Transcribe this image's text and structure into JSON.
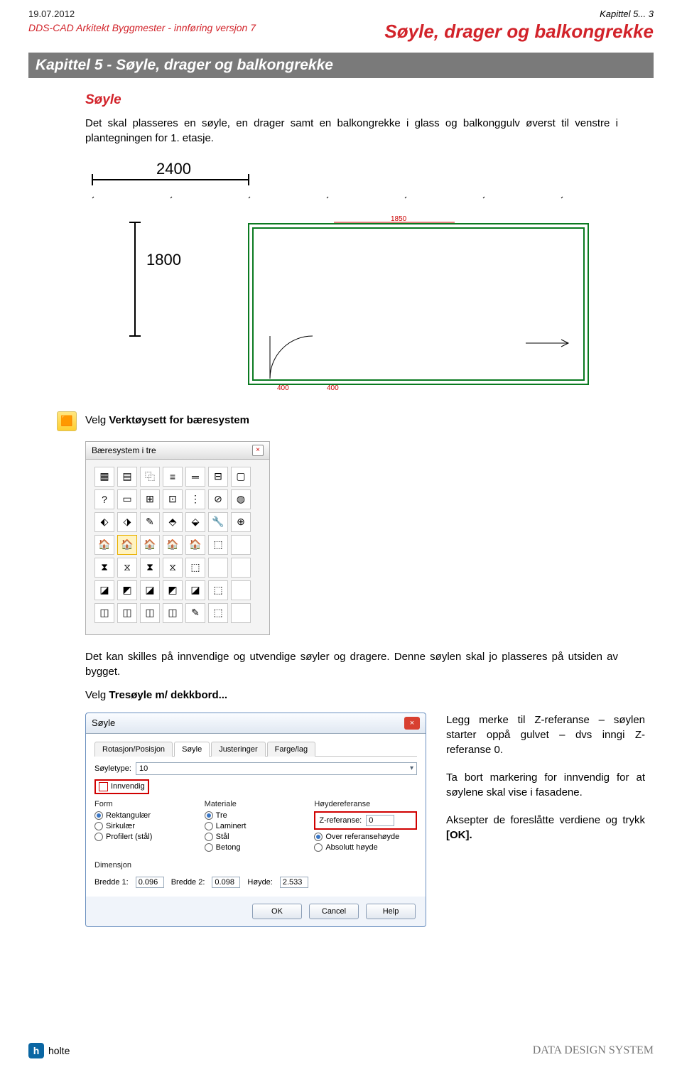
{
  "header": {
    "date": "19.07.2012",
    "subline": "DDS-CAD Arkitekt Byggmester - innføring versjon 7",
    "chapter_ref": "Kapittel 5... 3",
    "title": "Søyle, drager og balkongrekke"
  },
  "chapter_bar": "Kapittel 5  - Søyle, drager og balkongrekke",
  "section": {
    "heading": "Søyle",
    "intro": "Det skal plasseres en søyle, en drager samt en balkongrekke i glass og balkonggulv øverst til venstre i plantegningen for 1. etasje."
  },
  "plan": {
    "dim_top": "2400",
    "dim_left": "1800",
    "small_dim_1850": "1850",
    "small_dim_400a": "400",
    "small_dim_400b": "400"
  },
  "tool_line": {
    "prefix": "Velg ",
    "bold": "Verktøysett for bæresystem"
  },
  "palette": {
    "title": "Bæresystem i tre"
  },
  "after_palette": {
    "line1": "Det kan skilles på innvendige og utvendige søyler og dragere. Denne søylen skal jo plasseres på utsiden av bygget.",
    "line2_prefix": "Velg ",
    "line2_bold": "Tresøyle m/ dekkbord...",
    "line2_suffix": ""
  },
  "dialog": {
    "title": "Søyle",
    "tabs": [
      "Rotasjon/Posisjon",
      "Søyle",
      "Justeringer",
      "Farge/lag"
    ],
    "active_tab": 1,
    "soyletype_label": "Søyletype:",
    "soyletype_value": "10",
    "innvendig_label": "Innvendig",
    "col_form": "Form",
    "form_opts": [
      "Rektangulær",
      "Sirkulær",
      "Profilert (stål)"
    ],
    "form_sel": 0,
    "col_mat": "Materiale",
    "mat_opts": [
      "Tre",
      "Laminert",
      "Stål",
      "Betong"
    ],
    "mat_sel": 0,
    "col_href": "Høydereferanse",
    "zref_label": "Z-referanse:",
    "zref_val": "0",
    "href_opts": [
      "Over referansehøyde",
      "Absolutt høyde"
    ],
    "href_sel": 0,
    "dim_label": "Dimensjon",
    "b1_label": "Bredde 1:",
    "b1_val": "0.096",
    "b2_label": "Bredde 2:",
    "b2_val": "0.098",
    "h_label": "Høyde:",
    "h_val": "2.533",
    "btn_ok": "OK",
    "btn_cancel": "Cancel",
    "btn_help": "Help"
  },
  "sidenotes": {
    "p1": "Legg merke til Z-referanse – søylen starter oppå gulvet – dvs inngi Z-referanse 0.",
    "p2": "Ta bort markering for innvendig for at søylene skal vise i fasadene.",
    "p3_prefix": "Aksepter de foreslåtte verdiene og trykk ",
    "p3_bold": "[OK]."
  },
  "footer": {
    "left_brand": "holte",
    "right_brand": "DATA DESIGN SYSTEM"
  }
}
